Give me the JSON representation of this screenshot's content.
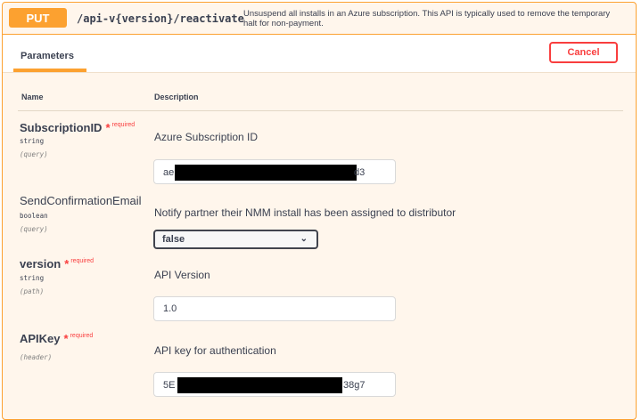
{
  "operation": {
    "method": "PUT",
    "path": "/api-v{version}/reactivate",
    "summary": "Unsuspend all installs in an Azure subscription. This API is typically used to remove the temporary halt for non-payment."
  },
  "tabs": {
    "parameters_label": "Parameters"
  },
  "actions": {
    "cancel_label": "Cancel"
  },
  "table": {
    "name_header": "Name",
    "description_header": "Description"
  },
  "required_marker": "*",
  "required_text": "required",
  "params": [
    {
      "name": "SubscriptionID",
      "required": true,
      "type": "string",
      "in": "(query)",
      "description": "Azure Subscription ID",
      "value_prefix": "ae",
      "value_suffix": "d3"
    },
    {
      "name": "SendConfirmationEmail",
      "required": false,
      "type": "boolean",
      "in": "(query)",
      "description": "Notify partner their NMM install has been assigned to distributor",
      "selected": "false"
    },
    {
      "name": "version",
      "required": true,
      "type": "string",
      "in": "(path)",
      "description": "API Version",
      "value": "1.0"
    },
    {
      "name": "APIKey",
      "required": true,
      "type": "",
      "in": "(header)",
      "description": "API key for authentication",
      "value_prefix": "5E",
      "value_suffix": "38g7"
    }
  ],
  "icons": {
    "select_chevron": "chevron-down-icon"
  },
  "colors": {
    "put_accent": "#fca130",
    "cancel_red": "#f93e3e",
    "required_red": "#f93e3e"
  }
}
